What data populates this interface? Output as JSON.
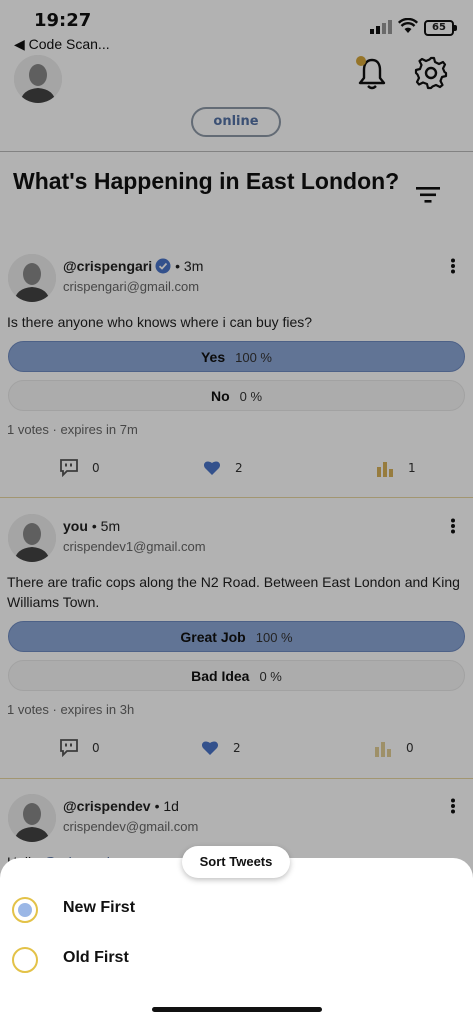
{
  "status": {
    "time": "19:27",
    "back_app": "◀ Code Scan...",
    "battery": "65"
  },
  "header": {
    "online_label": "online",
    "page_title": "What's Happening in East London?"
  },
  "posts": [
    {
      "handle": "@crispengari",
      "verified": true,
      "ago": "• 3m",
      "email": "crispengari@gmail.com",
      "text": "Is there anyone who knows where i can buy fies?",
      "options": [
        {
          "label": "Yes",
          "pct": "100 %"
        },
        {
          "label": "No",
          "pct": "0 %"
        }
      ],
      "votes": "1 votes · expires in 7m",
      "comments": "0",
      "likes": "2",
      "flags": "1"
    },
    {
      "handle": "you",
      "verified": false,
      "ago": "• 5m",
      "email": "crispendev1@gmail.com",
      "text": "There are trafic cops along the N2 Road. Between East London and King Williams Town.",
      "options": [
        {
          "label": "Great Job",
          "pct": "100 %"
        },
        {
          "label": "Bad Idea",
          "pct": "0 %"
        }
      ],
      "votes": "1 votes · expires in 3h",
      "comments": "0",
      "likes": "2",
      "flags": "0"
    },
    {
      "handle": "@crispendev",
      "verified": false,
      "ago": "• 1d",
      "email": "crispendev@gmail.com",
      "text_prefix": "Hello ",
      "text_mention": "@crispendev"
    }
  ],
  "sheet": {
    "chip_label": "Sort Tweets",
    "options": [
      {
        "label": "New First",
        "selected": true
      },
      {
        "label": "Old First",
        "selected": false
      }
    ]
  },
  "colors": {
    "accent": "#5573a6",
    "winner_fill": "#8ca6d6",
    "radio_border": "#e3c248",
    "bell_dot": "#d6a73a"
  }
}
